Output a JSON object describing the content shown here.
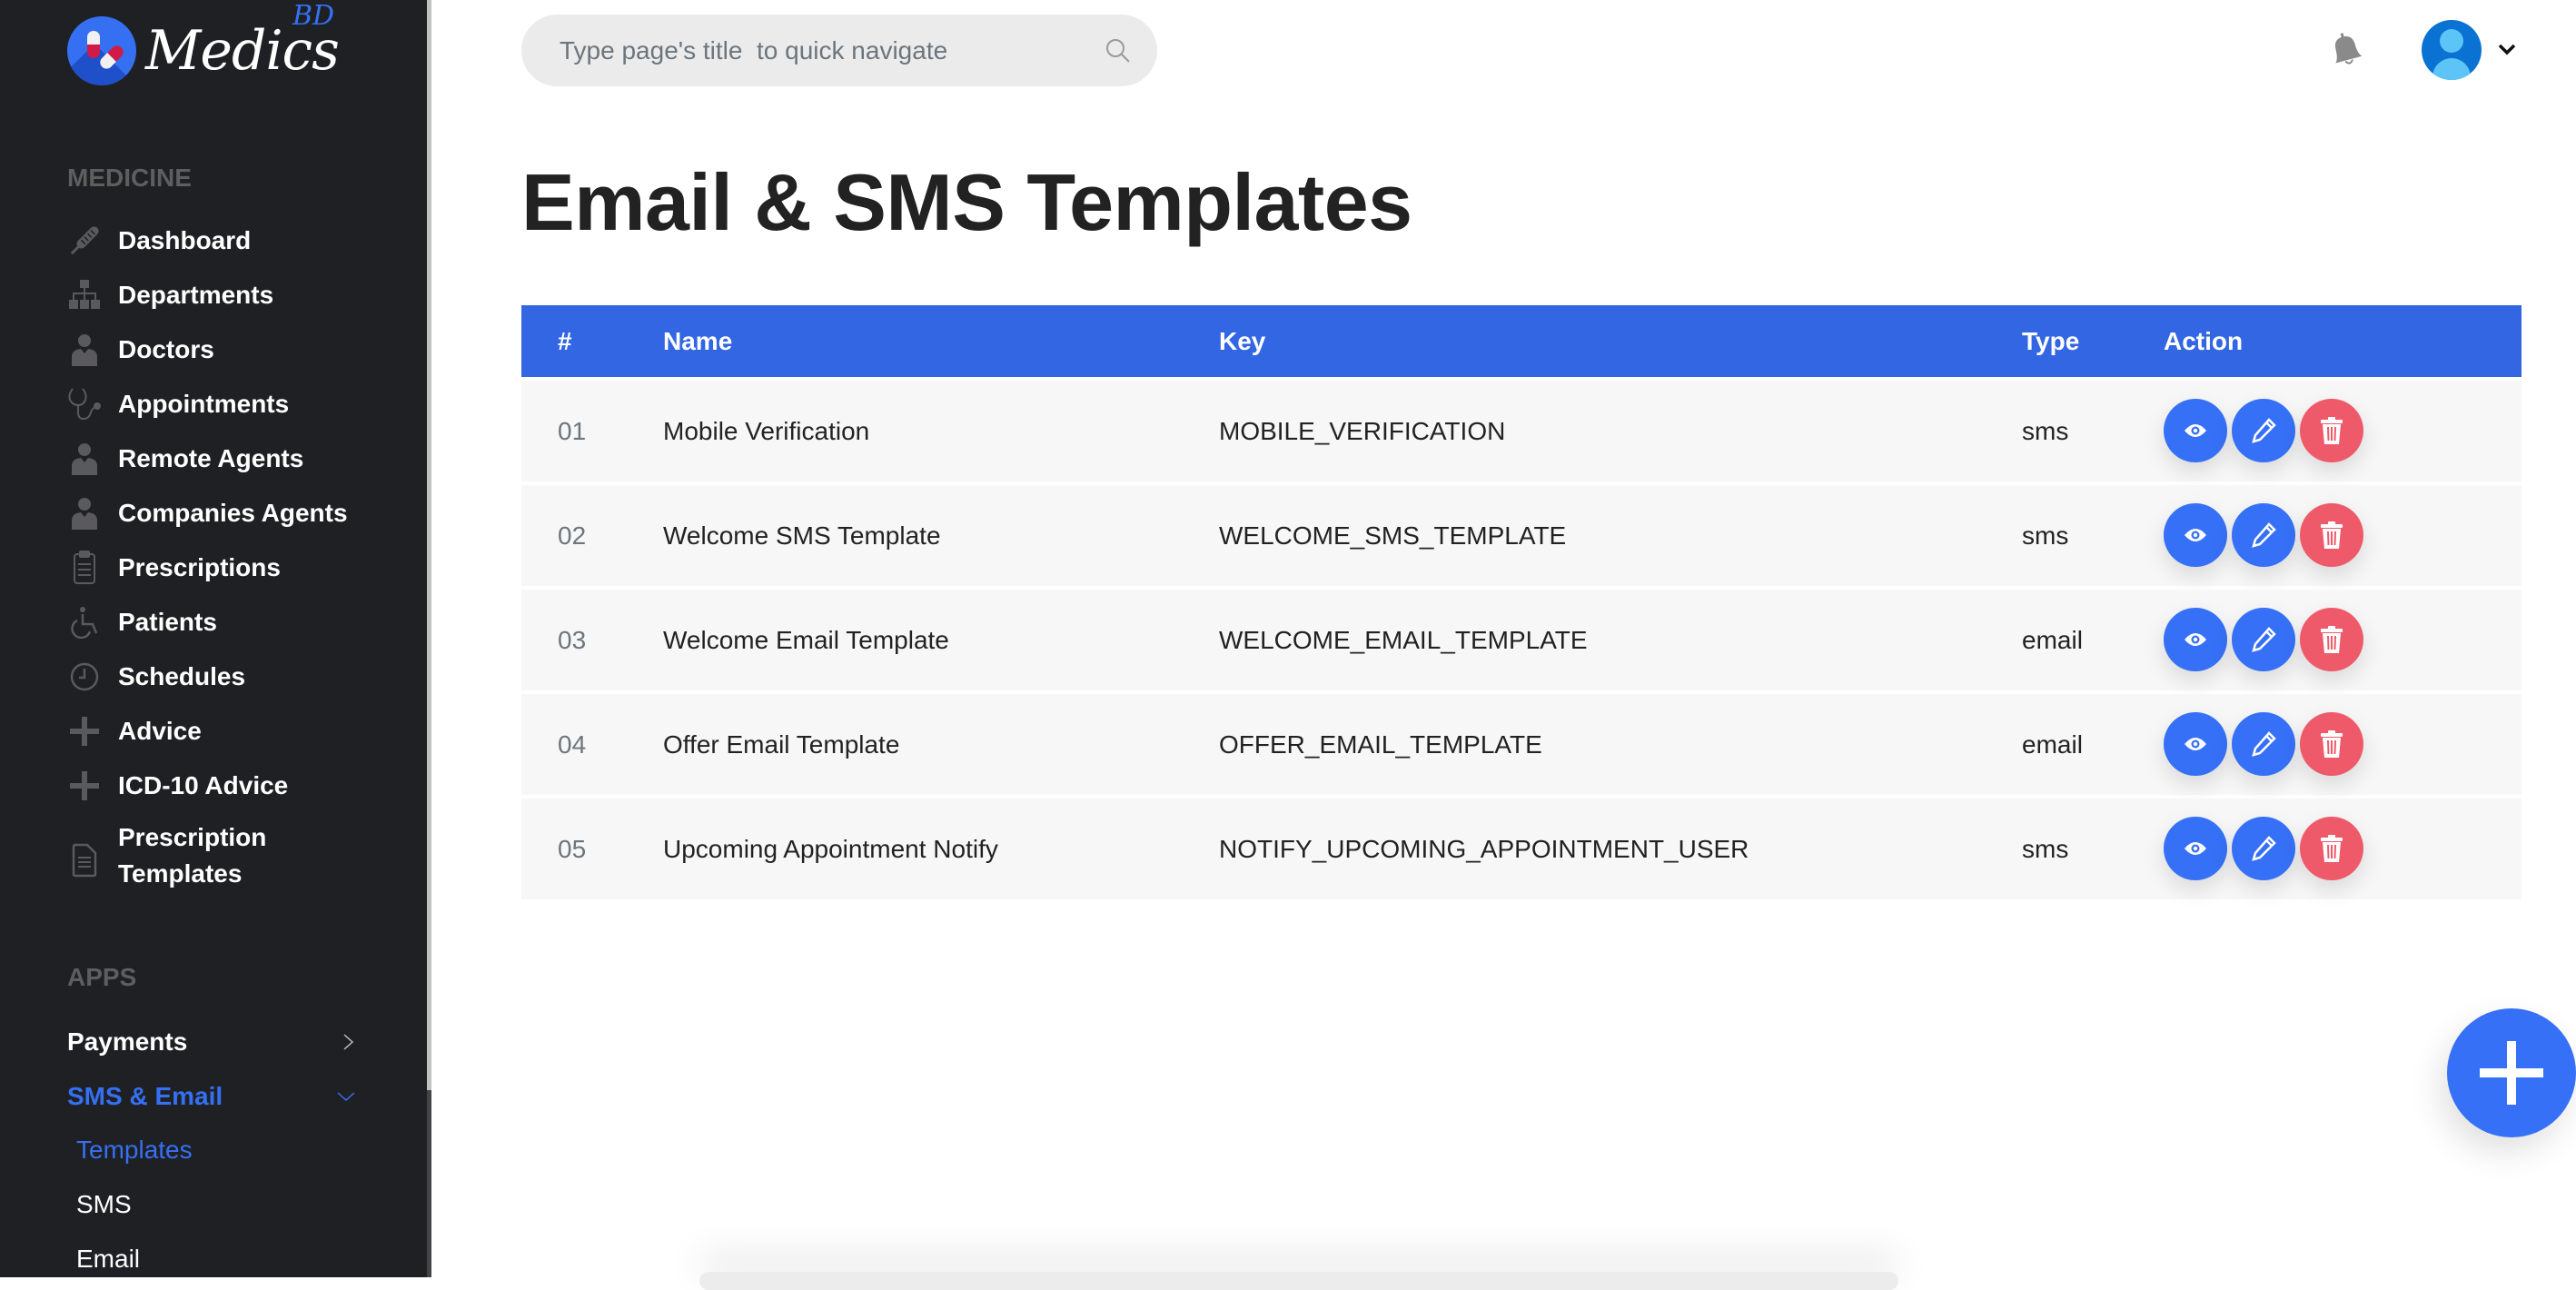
{
  "brand": {
    "name": "Medics",
    "suffix": "BD",
    "accent_color": "#3570f3"
  },
  "sidebar": {
    "section_medicine": "MEDICINE",
    "items": [
      {
        "label": "Dashboard",
        "icon": "thermometer-icon"
      },
      {
        "label": "Departments",
        "icon": "sitemap-icon"
      },
      {
        "label": "Doctors",
        "icon": "doctor-icon"
      },
      {
        "label": "Appointments",
        "icon": "stethoscope-icon"
      },
      {
        "label": "Remote Agents",
        "icon": "doctor-icon"
      },
      {
        "label": "Companies Agents",
        "icon": "doctor-icon"
      },
      {
        "label": "Prescriptions",
        "icon": "clipboard-icon"
      },
      {
        "label": "Patients",
        "icon": "wheelchair-icon"
      },
      {
        "label": "Schedules",
        "icon": "clock-icon"
      },
      {
        "label": "Advice",
        "icon": "plus-icon"
      },
      {
        "label": "ICD-10 Advice",
        "icon": "plus-icon"
      },
      {
        "label_line1": "Prescription",
        "label_line2": "Templates",
        "icon": "document-icon"
      }
    ],
    "section_apps": "APPS",
    "apps": [
      {
        "label": "Payments",
        "expanded": false
      },
      {
        "label": "SMS & Email",
        "expanded": true,
        "active": true
      }
    ],
    "sub_items": [
      {
        "label": "Templates",
        "active": true
      },
      {
        "label": "SMS",
        "active": false
      },
      {
        "label": "Email",
        "active": false
      }
    ]
  },
  "topbar": {
    "search_placeholder": "Type page's title  to quick navigate",
    "search_value": ""
  },
  "page": {
    "title": "Email & SMS Templates"
  },
  "table": {
    "header_color": "#3366e3",
    "columns": {
      "num": "#",
      "name": "Name",
      "key": "Key",
      "type": "Type",
      "action": "Action"
    },
    "rows": [
      {
        "num": "01",
        "name": "Mobile Verification",
        "key": "MOBILE_VERIFICATION",
        "type": "sms"
      },
      {
        "num": "02",
        "name": "Welcome SMS Template",
        "key": "WELCOME_SMS_TEMPLATE",
        "type": "sms"
      },
      {
        "num": "03",
        "name": "Welcome Email Template",
        "key": "WELCOME_EMAIL_TEMPLATE",
        "type": "email"
      },
      {
        "num": "04",
        "name": "Offer Email Template",
        "key": "OFFER_EMAIL_TEMPLATE",
        "type": "email"
      },
      {
        "num": "05",
        "name": "Upcoming Appointment Notify",
        "key": "NOTIFY_UPCOMING_APPOINTMENT_USER",
        "type": "sms"
      }
    ],
    "action_colors": {
      "view": "#3670f6",
      "edit": "#3670f6",
      "delete": "#ee5a6a"
    }
  }
}
